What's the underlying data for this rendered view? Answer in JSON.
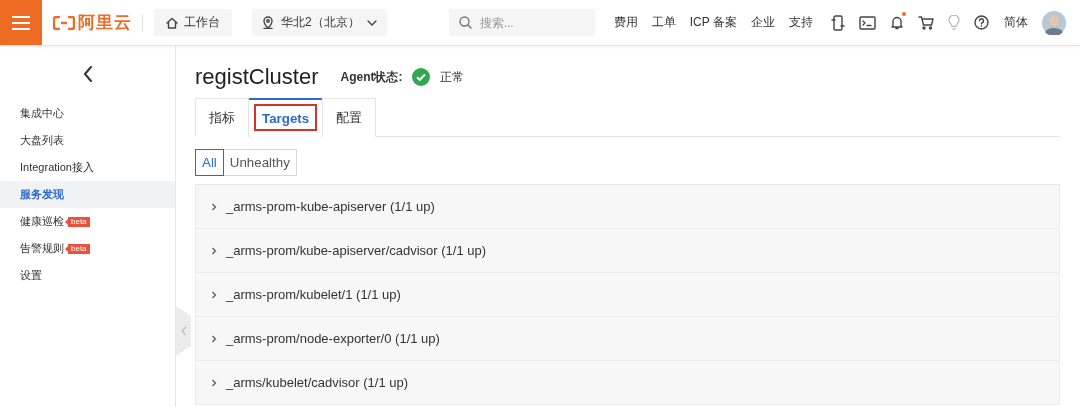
{
  "top_bar": {
    "logo": "阿里云",
    "workbench": "工作台",
    "region": "华北2（北京）",
    "search": {
      "placeholder": "搜索..."
    },
    "links": [
      "费用",
      "工单",
      "ICP 备案",
      "企业",
      "支持"
    ],
    "has_notification": true,
    "language": "简体"
  },
  "sidebar": {
    "items": [
      {
        "label": "集成中心",
        "selected": false
      },
      {
        "label": "大盘列表",
        "selected": false
      },
      {
        "label": "Integration接入",
        "selected": false
      },
      {
        "label": "服务发现",
        "selected": true
      },
      {
        "label": "健康巡检",
        "selected": false,
        "badge": "beta"
      },
      {
        "label": "告警规则",
        "selected": false,
        "badge": "beta"
      },
      {
        "label": "设置",
        "selected": false
      }
    ]
  },
  "page": {
    "title": "registCluster",
    "agent_label": "Agent状态:",
    "agent_ok": true,
    "agent_status": "正常"
  },
  "tabs": [
    {
      "label": "指标",
      "selected": false,
      "highlighted": false
    },
    {
      "label": "Targets",
      "selected": true,
      "highlighted": true
    },
    {
      "label": "配置",
      "selected": false,
      "highlighted": false
    }
  ],
  "filters": [
    {
      "label": "All",
      "selected": true
    },
    {
      "label": "Unhealthy",
      "selected": false
    }
  ],
  "targets": [
    {
      "name": "_arms-prom-kube-apiserver (1/1 up)",
      "expanded": false
    },
    {
      "name": "_arms-prom/kube-apiserver/cadvisor (1/1 up)",
      "expanded": false
    },
    {
      "name": "_arms-prom/kubelet/1 (1/1 up)",
      "expanded": false
    },
    {
      "name": "_arms-prom/node-exporter/0 (1/1 up)",
      "expanded": false
    },
    {
      "name": "_arms/kubelet/cadvisor (1/1 up)",
      "expanded": false
    }
  ]
}
